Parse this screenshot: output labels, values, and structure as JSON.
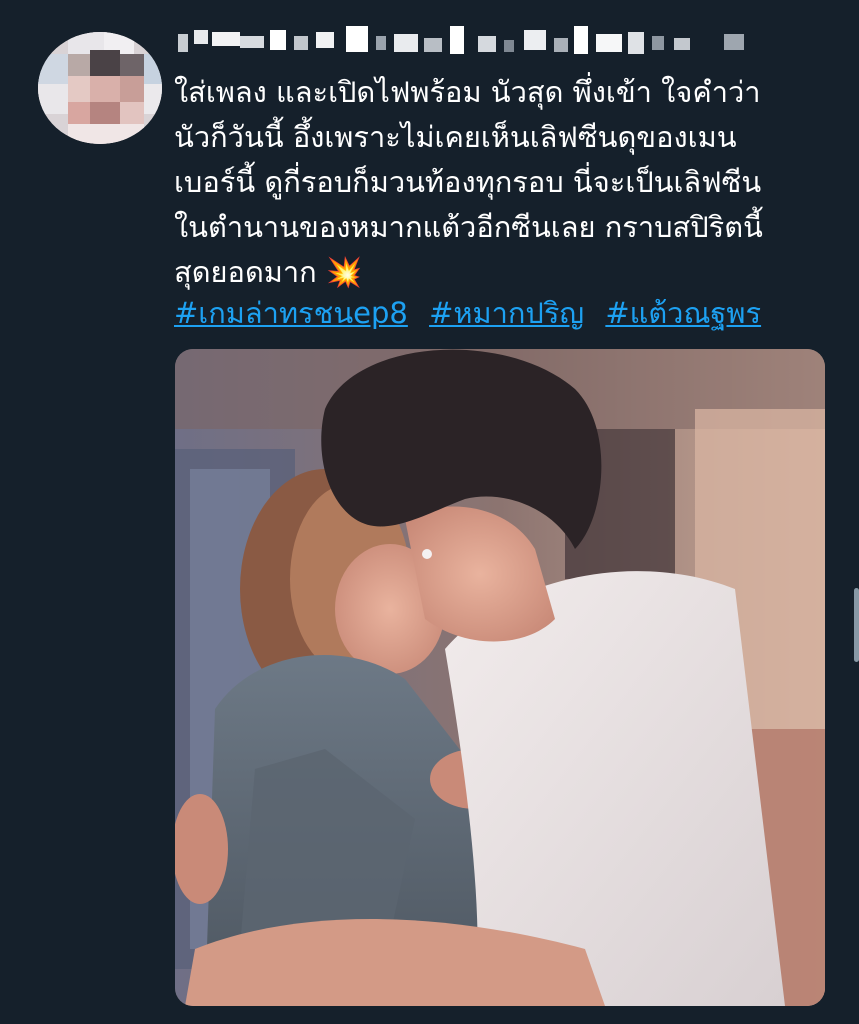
{
  "tweet": {
    "text_lines": [
      "ใส่เพลง และเปิดไฟพร้อม นัวสุด พึ่งเข้า ใจคำว่า",
      "นัวก็วันนี้ อึ้งเพราะไม่เคยเห็นเลิฟซีนดุของเมน",
      "เบอร์นี้ ดูกี่รอบก็มวนท้องทุกรอบ นี่จะเป็นเลิฟซีน",
      "ในตำนานของหมากแต้วอีกซีนเลย กราบสปิริตนี้",
      "สุดยอดมาก"
    ],
    "emoji": "💥",
    "hashtags": [
      "#เกมล่าทรชนep8",
      "#หมากปริญ",
      "#แต้วณฐพร"
    ]
  },
  "colors": {
    "background": "#15202b",
    "text": "#ffffff",
    "link": "#1da1f2"
  }
}
